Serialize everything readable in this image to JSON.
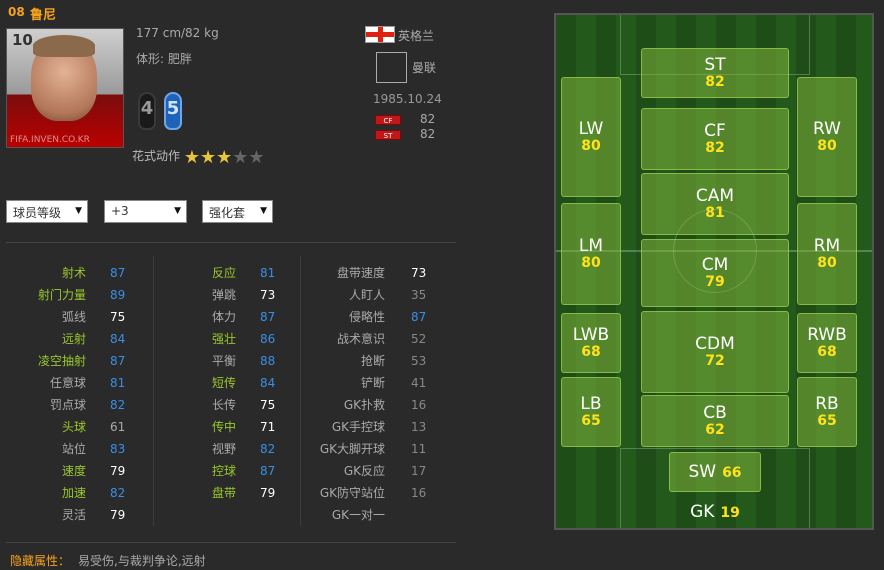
{
  "player": {
    "season": "08",
    "name": "鲁尼",
    "number": "10",
    "watermark": "FIFA.INVEN.CO.KR",
    "height_weight": "177 cm/82 kg",
    "body_type": "体形: 肥胖",
    "left_foot": "4",
    "right_foot": "5",
    "skill_label": "花式动作",
    "skill_stars": 3,
    "skill_stars_max": 5,
    "nationality": "英格兰",
    "club": "曼联",
    "dob": "1985.10.24",
    "positions": [
      {
        "pos": "CF",
        "value": "82"
      },
      {
        "pos": "ST",
        "value": "82"
      }
    ],
    "flag_colors": {
      "white": "#ffffff",
      "red": "#dd2211"
    }
  },
  "selects": [
    {
      "value": "球员等级"
    },
    {
      "value": "+3"
    },
    {
      "value": "强化套"
    }
  ],
  "stats": {
    "col1": [
      {
        "label": "射术",
        "value": "87",
        "label_color": "#9ac82d",
        "value_color": "#3a8ee6"
      },
      {
        "label": "射门力量",
        "value": "89",
        "label_color": "#9ac82d",
        "value_color": "#3a8ee6"
      },
      {
        "label": "弧线",
        "value": "75",
        "label_color": "#aaaaaa",
        "value_color": "#ffffff"
      },
      {
        "label": "远射",
        "value": "84",
        "label_color": "#9ac82d",
        "value_color": "#3a8ee6"
      },
      {
        "label": "凌空抽射",
        "value": "87",
        "label_color": "#9ac82d",
        "value_color": "#3a8ee6"
      },
      {
        "label": "任意球",
        "value": "81",
        "label_color": "#aaaaaa",
        "value_color": "#3a8ee6"
      },
      {
        "label": "罚点球",
        "value": "82",
        "label_color": "#aaaaaa",
        "value_color": "#3a8ee6"
      },
      {
        "label": "头球",
        "value": "61",
        "label_color": "#9ac82d",
        "value_color": "#aaaaaa"
      },
      {
        "label": "站位",
        "value": "83",
        "label_color": "#aaaaaa",
        "value_color": "#3a8ee6"
      },
      {
        "label": "速度",
        "value": "79",
        "label_color": "#9ac82d",
        "value_color": "#ffffff"
      },
      {
        "label": "加速",
        "value": "82",
        "label_color": "#9ac82d",
        "value_color": "#3a8ee6"
      },
      {
        "label": "灵活",
        "value": "79",
        "label_color": "#aaaaaa",
        "value_color": "#ffffff"
      }
    ],
    "col2": [
      {
        "label": "反应",
        "value": "81",
        "label_color": "#9ac82d",
        "value_color": "#3a8ee6"
      },
      {
        "label": "弹跳",
        "value": "73",
        "label_color": "#aaaaaa",
        "value_color": "#ffffff"
      },
      {
        "label": "体力",
        "value": "87",
        "label_color": "#aaaaaa",
        "value_color": "#3a8ee6"
      },
      {
        "label": "强壮",
        "value": "86",
        "label_color": "#9ac82d",
        "value_color": "#3a8ee6"
      },
      {
        "label": "平衡",
        "value": "88",
        "label_color": "#aaaaaa",
        "value_color": "#3a8ee6"
      },
      {
        "label": "短传",
        "value": "84",
        "label_color": "#9ac82d",
        "value_color": "#3a8ee6"
      },
      {
        "label": "长传",
        "value": "75",
        "label_color": "#aaaaaa",
        "value_color": "#ffffff"
      },
      {
        "label": "传中",
        "value": "71",
        "label_color": "#9ac82d",
        "value_color": "#ffffff"
      },
      {
        "label": "视野",
        "value": "82",
        "label_color": "#aaaaaa",
        "value_color": "#3a8ee6"
      },
      {
        "label": "控球",
        "value": "87",
        "label_color": "#9ac82d",
        "value_color": "#3a8ee6"
      },
      {
        "label": "盘带",
        "value": "79",
        "label_color": "#9ac82d",
        "value_color": "#ffffff"
      }
    ],
    "col3": [
      {
        "label": "盘带速度",
        "value": "73",
        "label_color": "#aaaaaa",
        "value_color": "#ffffff"
      },
      {
        "label": "人盯人",
        "value": "35",
        "label_color": "#aaaaaa",
        "value_color": "#888888"
      },
      {
        "label": "侵略性",
        "value": "87",
        "label_color": "#aaaaaa",
        "value_color": "#3a8ee6"
      },
      {
        "label": "战术意识",
        "value": "52",
        "label_color": "#aaaaaa",
        "value_color": "#888888"
      },
      {
        "label": "抢断",
        "value": "53",
        "label_color": "#aaaaaa",
        "value_color": "#888888"
      },
      {
        "label": "铲断",
        "value": "41",
        "label_color": "#aaaaaa",
        "value_color": "#888888"
      },
      {
        "label": "GK扑救",
        "value": "16",
        "label_color": "#aaaaaa",
        "value_color": "#888888"
      },
      {
        "label": "GK手控球",
        "value": "13",
        "label_color": "#aaaaaa",
        "value_color": "#888888"
      },
      {
        "label": "GK大脚开球",
        "value": "11",
        "label_color": "#aaaaaa",
        "value_color": "#888888"
      },
      {
        "label": "GK反应",
        "value": "17",
        "label_color": "#aaaaaa",
        "value_color": "#888888"
      },
      {
        "label": "GK防守站位",
        "value": "16",
        "label_color": "#aaaaaa",
        "value_color": "#888888"
      },
      {
        "label": "GK一对一",
        "value": "",
        "label_color": "#aaaaaa",
        "value_color": "#888888"
      }
    ]
  },
  "hidden_traits": {
    "label": "隐藏属性：",
    "value": "易受伤,与裁判争论,远射"
  },
  "pitch": {
    "positions": [
      {
        "pos": "ST",
        "rating": "82"
      },
      {
        "pos": "LW",
        "rating": "80"
      },
      {
        "pos": "CF",
        "rating": "82"
      },
      {
        "pos": "RW",
        "rating": "80"
      },
      {
        "pos": "CAM",
        "rating": "81"
      },
      {
        "pos": "LM",
        "rating": "80"
      },
      {
        "pos": "CM",
        "rating": "79"
      },
      {
        "pos": "RM",
        "rating": "80"
      },
      {
        "pos": "LWB",
        "rating": "68"
      },
      {
        "pos": "CDM",
        "rating": "72"
      },
      {
        "pos": "RWB",
        "rating": "68"
      },
      {
        "pos": "LB",
        "rating": "65"
      },
      {
        "pos": "CB",
        "rating": "62"
      },
      {
        "pos": "RB",
        "rating": "65"
      },
      {
        "pos": "SW",
        "rating": "66"
      },
      {
        "pos": "GK",
        "rating": "19"
      }
    ]
  }
}
